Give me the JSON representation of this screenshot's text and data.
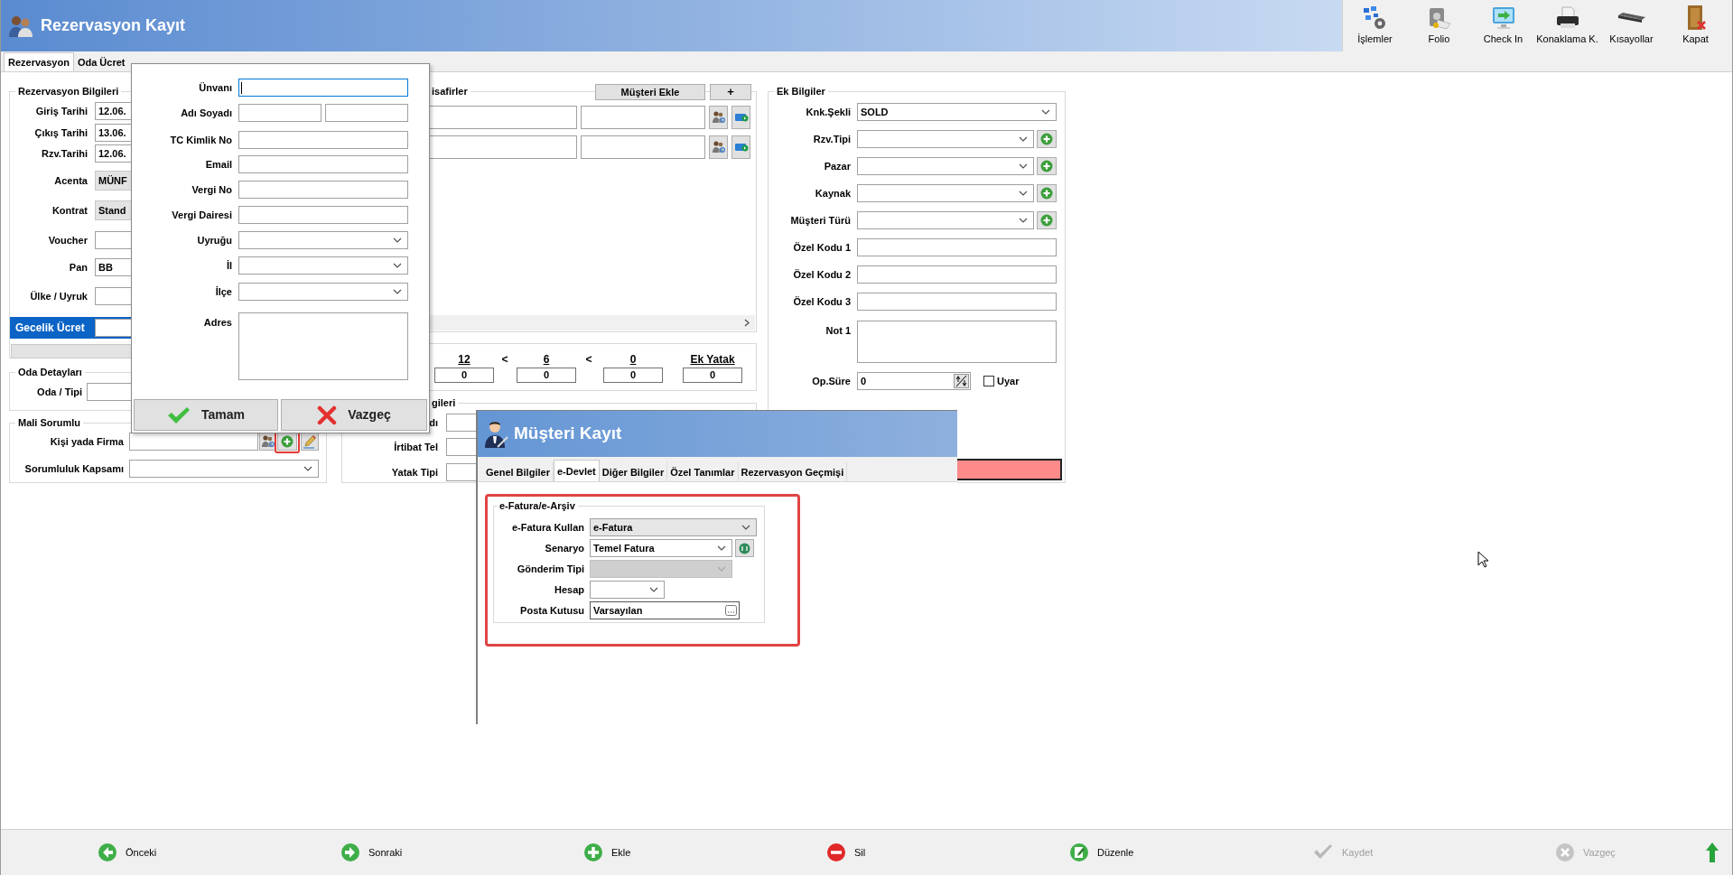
{
  "window": {
    "title": "Rezervasyon Kayıt"
  },
  "toolbar": [
    {
      "label": "İşlemler",
      "kind": "operations"
    },
    {
      "label": "Folio",
      "kind": "folio"
    },
    {
      "label": "Check In",
      "kind": "checkin"
    },
    {
      "label": "Konaklama K.",
      "kind": "print"
    },
    {
      "label": "Kısayollar",
      "kind": "keyboard"
    },
    {
      "label": "Kapat",
      "kind": "exit"
    }
  ],
  "tabs": [
    {
      "label": "Rezervasyon",
      "selected": true
    },
    {
      "label": "Oda Ücret",
      "selected": false
    }
  ],
  "reservation_info": {
    "title": "Rezervasyon Bilgileri",
    "fields": [
      {
        "label": "Giriş Tarihi",
        "kind": "text",
        "value": "12.06."
      },
      {
        "label": "Çıkış Tarihi",
        "kind": "text",
        "value": "13.06."
      },
      {
        "label": "Rzv.Tarihi",
        "kind": "text",
        "value": "12.06."
      },
      {
        "label": "Acenta",
        "kind": "readonly",
        "value": "MÜNF"
      },
      {
        "label": "Kontrat",
        "kind": "readonly",
        "value": "Stand"
      },
      {
        "label": "Voucher",
        "kind": "text"
      },
      {
        "label": "Pan",
        "kind": "text",
        "value": "BB"
      },
      {
        "label": "Ülke / Uyruk",
        "kind": "text"
      },
      {
        "label": "Gecelik Ücret",
        "kind": "highlight"
      }
    ]
  },
  "room_details": {
    "title": "Oda Detayları",
    "fields": [
      {
        "label": "Oda / Tipi"
      }
    ]
  },
  "financial": {
    "title": "Mali Sorumlu",
    "fields": [
      {
        "label": "Kişi yada Firma",
        "kind": "lookup"
      },
      {
        "label": "Sorumluluk Kapsamı",
        "kind": "select"
      }
    ]
  },
  "guests": {
    "title": "isafirler",
    "add_button": "Müşteri Ekle",
    "plus_button": "+",
    "rows": [
      {
        "kind": "guest"
      },
      {
        "kind": "guest"
      }
    ]
  },
  "counts": {
    "items": [
      {
        "label": "12",
        "value": "0"
      },
      {
        "label": "6",
        "value": "0"
      },
      {
        "label": "0",
        "value": "0"
      },
      {
        "label": "Ek Yatak",
        "value": "0"
      }
    ],
    "separators": [
      "<",
      "<"
    ]
  },
  "contact": {
    "title": "gileri",
    "fields": [
      {
        "label": "dı"
      },
      {
        "label": "İrtibat Tel"
      },
      {
        "label": "Yatak Tipi"
      }
    ]
  },
  "extra": {
    "title": "Ek Bilgiler",
    "fields": [
      {
        "label": "Knk.Şekli",
        "kind": "select",
        "value": "SOLD"
      },
      {
        "label": "Rzv.Tipi",
        "kind": "select_add"
      },
      {
        "label": "Pazar",
        "kind": "select_add"
      },
      {
        "label": "Kaynak",
        "kind": "select_add"
      },
      {
        "label": "Müşteri Türü",
        "kind": "select_add"
      },
      {
        "label": "Özel Kodu 1",
        "kind": "text"
      },
      {
        "label": "Özel Kodu 2",
        "kind": "text"
      },
      {
        "label": "Özel Kodu 3",
        "kind": "text"
      },
      {
        "label": "Not 1",
        "kind": "memo"
      },
      {
        "label": "Op.Süre",
        "kind": "spin",
        "value": "0"
      }
    ],
    "warn": {
      "label": "Uyar",
      "checked": false
    }
  },
  "customer_form": {
    "fields": [
      {
        "label": "Ünvanı",
        "kind": "text",
        "focused": true
      },
      {
        "label": "Adı Soyadı",
        "kind": "pair",
        "focused": false
      },
      {
        "label": "TC Kimlik No",
        "kind": "text",
        "focused": false
      },
      {
        "label": "Email",
        "kind": "text",
        "focused": false
      },
      {
        "label": "Vergi No",
        "kind": "text",
        "focused": false
      },
      {
        "label": "Vergi Dairesi",
        "kind": "text",
        "focused": false
      },
      {
        "label": "Uyruğu",
        "kind": "select",
        "focused": false
      },
      {
        "label": "İl",
        "kind": "select",
        "focused": false
      },
      {
        "label": "İlçe",
        "kind": "select",
        "focused": false
      },
      {
        "label": "Adres",
        "kind": "memo",
        "focused": false
      }
    ],
    "buttons": [
      {
        "label": "Tamam",
        "kind": "ok"
      },
      {
        "label": "Vazgeç",
        "kind": "cancel"
      }
    ]
  },
  "customer_window": {
    "title": "Müşteri Kayıt",
    "tabs": [
      {
        "label": "Genel Bilgiler",
        "selected": false
      },
      {
        "label": "e-Devlet",
        "selected": true
      },
      {
        "label": "Diğer Bilgiler",
        "selected": false
      },
      {
        "label": "Özel Tanımlar",
        "selected": false
      },
      {
        "label": "Rezervasyon Geçmişi",
        "selected": false
      }
    ],
    "group": {
      "title": "e-Fatura/e-Arşiv",
      "fields": [
        {
          "label": "e-Fatura Kullan",
          "kind": "select",
          "value": "e-Fatura",
          "disabled": false
        },
        {
          "label": "Senaryo",
          "kind": "select_action",
          "value": "Temel Fatura",
          "disabled": false
        },
        {
          "label": "Gönderim Tipi",
          "kind": "select_action",
          "disabled": true
        },
        {
          "label": "Hesap",
          "kind": "select_short",
          "disabled": false
        },
        {
          "label": "Posta Kutusu",
          "kind": "browse",
          "value": "Varsayılan",
          "disabled": false
        }
      ]
    }
  },
  "bottom_bar": [
    {
      "label": "Önceki",
      "kind": "prev",
      "disabled": false
    },
    {
      "label": "Sonraki",
      "kind": "next",
      "disabled": false
    },
    {
      "label": "Ekle",
      "kind": "add",
      "disabled": false
    },
    {
      "label": "Sil",
      "kind": "delete",
      "disabled": false
    },
    {
      "label": "Düzenle",
      "kind": "edit",
      "disabled": false
    },
    {
      "label": "Kaydet",
      "kind": "save",
      "disabled": true
    },
    {
      "label": "Vazgeç",
      "kind": "cancel",
      "disabled": true
    }
  ]
}
